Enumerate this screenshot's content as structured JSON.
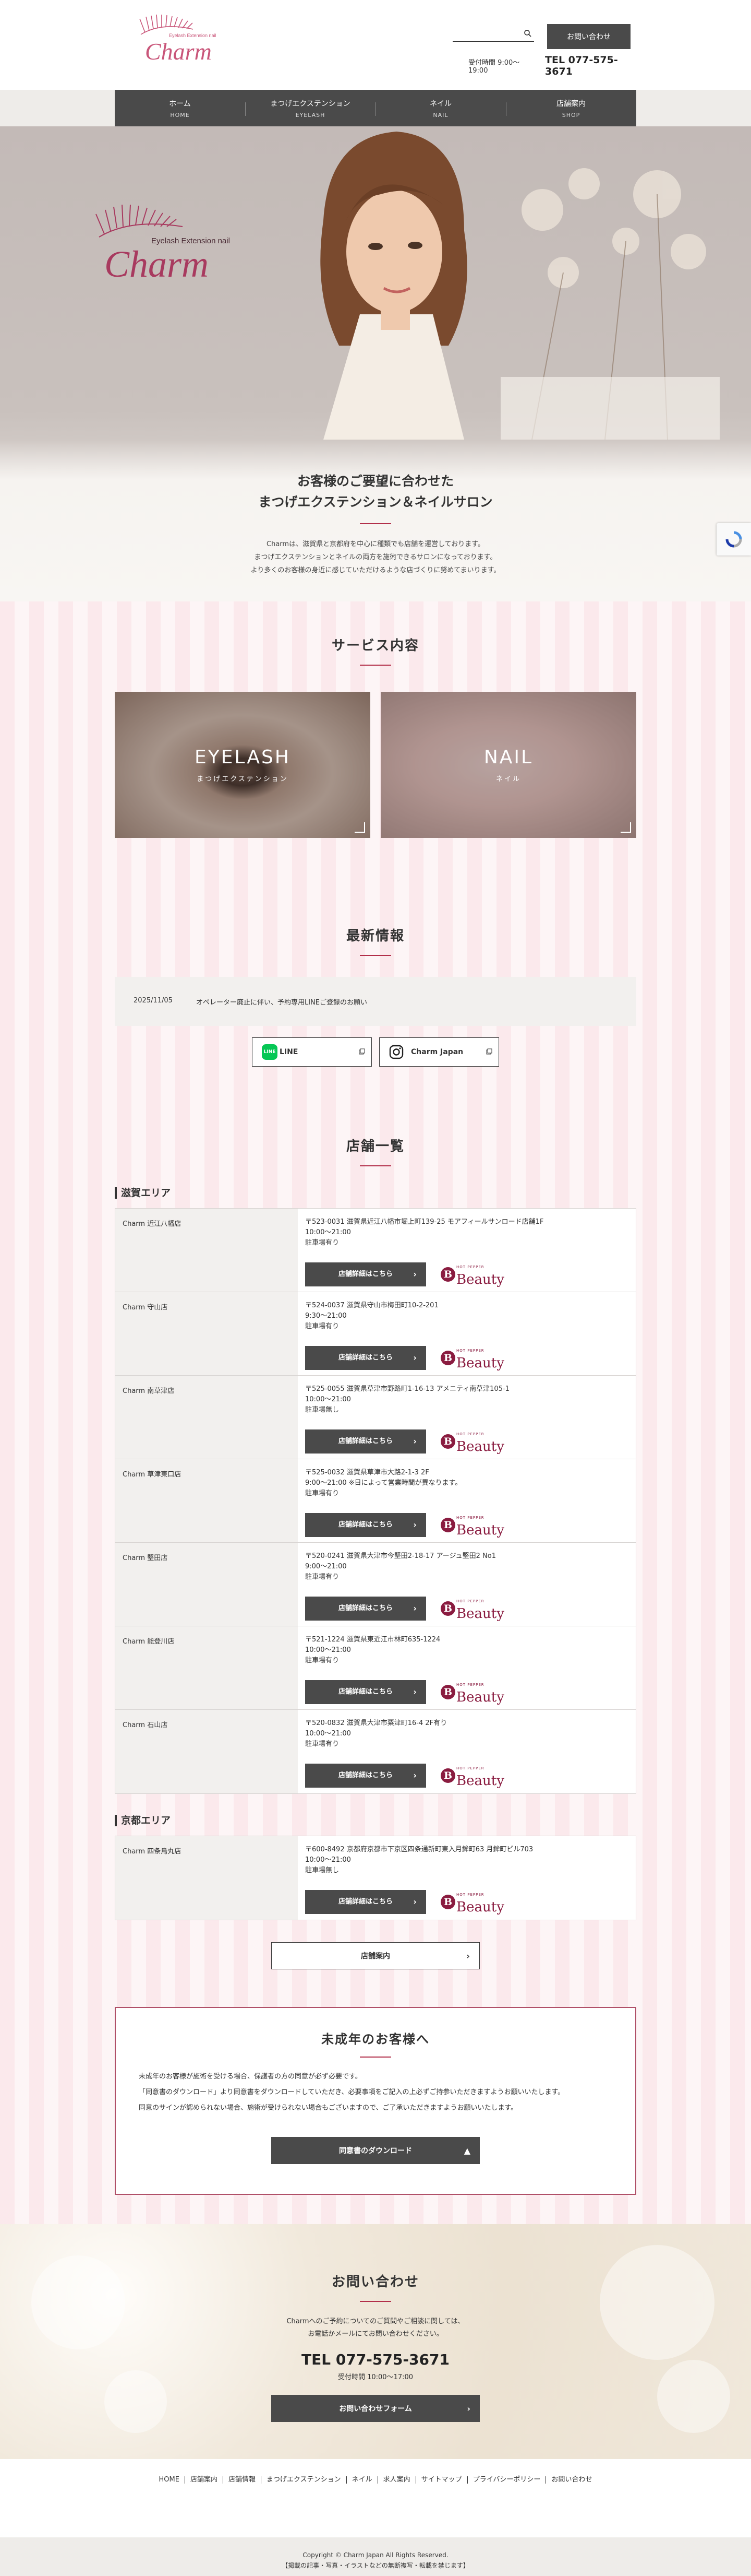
{
  "header": {
    "logo_text": "Charm",
    "logo_sub": "Eyelash Extension nail",
    "search_placeholder": "",
    "contact_button": "お問い合わせ",
    "hours": "受付時間 9:00～19:00",
    "tel": "TEL 077-575-3671"
  },
  "nav": [
    {
      "jp": "ホーム",
      "en": "HOME"
    },
    {
      "jp": "まつげエクステンション",
      "en": "EYELASH"
    },
    {
      "jp": "ネイル",
      "en": "NAIL"
    },
    {
      "jp": "店舗案内",
      "en": "SHOP"
    }
  ],
  "hero": {
    "logo_text": "Charm",
    "logo_sub": "Eyelash Extension nail",
    "title_line1": "お客様のご要望に合わせた",
    "title_line2": "まつげエクステンション＆ネイルサロン",
    "desc_line1": "Charmは、滋賀県と京都府を中心に種類でも店舗を運営しております。",
    "desc_line2": "まつげエクステンションとネイルの両方を施術できるサロンになっております。",
    "desc_line3": "より多くのお客様の身近に感じていただけるような店づくりに努めてまいります。"
  },
  "services": {
    "title": "サービス内容",
    "cards": [
      {
        "title": "EYELASH",
        "sub": "まつげエクステンション"
      },
      {
        "title": "NAIL",
        "sub": "ネイル"
      }
    ]
  },
  "news": {
    "title": "最新情報",
    "items": [
      {
        "date": "2025/11/05",
        "text": "オペレーター廃止に伴い、予約専用LINEご登録のお願い"
      }
    ],
    "line_label": "LINE",
    "line_icon_text": "LINE",
    "insta_label": "Charm Japan"
  },
  "stores": {
    "title": "店舗一覧",
    "detail_label": "店舗詳細はこちら",
    "hp_small": "HOT PEPPER",
    "hp_big": "Beauty",
    "areas": [
      {
        "name": "滋賀エリア",
        "stores": [
          {
            "name": "Charm 近江八幡店",
            "addr": "〒523-0031 滋賀県近江八幡市堀上町139-25 モアフィールサンロード店舗1F",
            "hours": "10:00～21:00",
            "parking": "駐車場有り"
          },
          {
            "name": "Charm 守山店",
            "addr": "〒524-0037 滋賀県守山市梅田町10-2-201",
            "hours": "9:30～21:00",
            "parking": "駐車場有り"
          },
          {
            "name": "Charm 南草津店",
            "addr": "〒525-0055 滋賀県草津市野路町1-16-13 アメニティ南草津105-1",
            "hours": "10:00～21:00",
            "parking": "駐車場無し"
          },
          {
            "name": "Charm 草津東口店",
            "addr": "〒525-0032 滋賀県草津市大路2-1-3 2F",
            "hours": "9:00～21:00 ※日によって営業時間が異なります。",
            "parking": "駐車場有り"
          },
          {
            "name": "Charm 堅田店",
            "addr": "〒520-0241 滋賀県大津市今堅田2-18-17 アージュ堅田2 No1",
            "hours": "9:00～21:00",
            "parking": "駐車場有り"
          },
          {
            "name": "Charm 能登川店",
            "addr": "〒521-1224 滋賀県東近江市林町635-1224",
            "hours": "10:00～21:00",
            "parking": "駐車場有り"
          },
          {
            "name": "Charm 石山店",
            "addr": "〒520-0832 滋賀県大津市粟津町16-4 2F有り",
            "hours": "10:00～21:00",
            "parking": "駐車場有り"
          }
        ]
      },
      {
        "name": "京都エリア",
        "stores": [
          {
            "name": "Charm 四条烏丸店",
            "addr": "〒600-8492 京都府京都市下京区四条通新町東入月鉾町63 月鉾町ビル703",
            "hours": "10:00～21:00",
            "parking": "駐車場無し"
          }
        ]
      }
    ],
    "guide_button": "店舗案内"
  },
  "minor": {
    "title": "未成年のお客様へ",
    "line1": "未成年のお客様が施術を受ける場合、保護者の方の同意が必ず必要です。",
    "line2": "「同意書のダウンロード」より同意書をダウンロードしていただき、必要事項をご記入の上必ずご持参いただきますようお願いいたします。",
    "line3": "同意のサインが認められない場合、施術が受けられない場合もございますので、ご了承いただきますようお願いいたします。",
    "download_button": "同意書のダウンロード"
  },
  "contact": {
    "title": "お問い合わせ",
    "desc_line1": "Charmへのご予約についてのご質問やご相談に関しては、",
    "desc_line2": "お電話かメールにてお問い合わせください。",
    "tel": "TEL 077-575-3671",
    "hours": "受付時間 10:00～17:00",
    "form_button": "お問い合わせフォーム"
  },
  "footer": {
    "links": [
      "HOME",
      "店舗案内",
      "店舗情報",
      "まつげエクステンション",
      "ネイル",
      "求人案内",
      "サイトマップ",
      "プライバシーポリシー",
      "お問い合わせ"
    ],
    "copyright": "Copyright © Charm Japan All Rights Reserved.",
    "notice": "【掲載の記事・写真・イラストなどの無断複写・転載を禁じます】"
  },
  "colors": {
    "accent": "#b22f4a",
    "dark": "#4a4a4a",
    "stripe_a": "#fbe9ec",
    "stripe_b": "#fdf5f6"
  }
}
